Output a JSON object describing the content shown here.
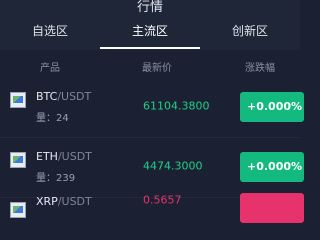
{
  "header": {
    "title": "行情"
  },
  "tabs": [
    {
      "label": "自选区"
    },
    {
      "label": "主流区"
    },
    {
      "label": "创新区"
    }
  ],
  "columns": {
    "product": "产品",
    "last_price": "最新价",
    "change": "涨跌幅"
  },
  "rows": [
    {
      "base": "BTC",
      "quote": "/USDT",
      "vol": "量：24",
      "price": "61104.3800",
      "change": "+0.000%"
    },
    {
      "base": "ETH",
      "quote": "/USDT",
      "vol": "量：239",
      "price": "4474.3000",
      "change": "+0.000%"
    },
    {
      "base": "XRP",
      "quote": "/USDT",
      "vol": "",
      "price": "0.5657",
      "change": ""
    }
  ],
  "colors": {
    "up": "#14b97f",
    "down": "#e6336b",
    "price_up": "#1fcf8a",
    "price_down": "#e6336b"
  },
  "icons": {
    "coin": "broken-image-icon"
  }
}
